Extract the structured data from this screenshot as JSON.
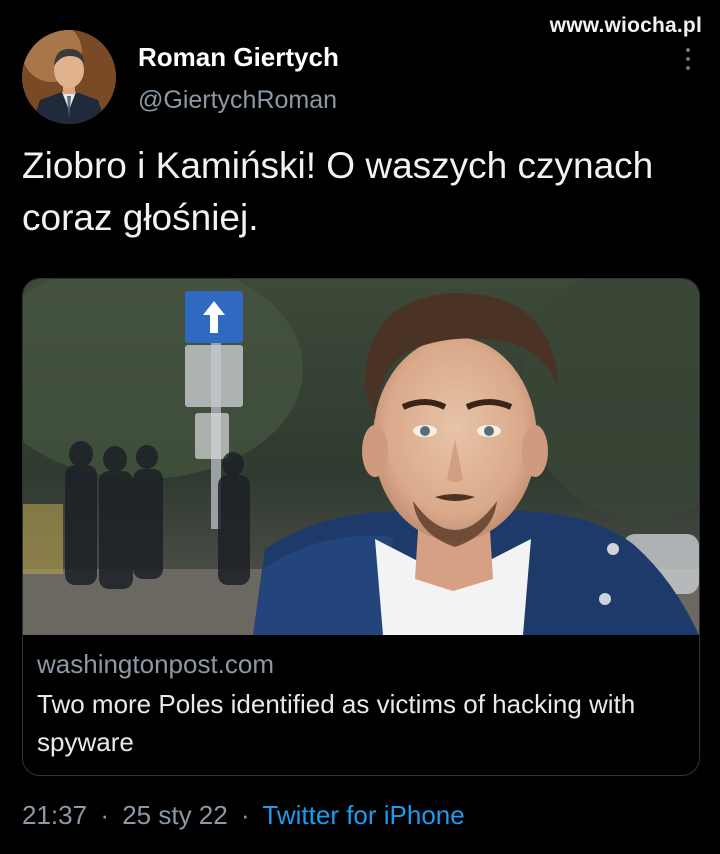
{
  "watermark": "www.wiocha.pl",
  "author": {
    "name": "Roman Giertych",
    "handle": "@GiertychRoman"
  },
  "tweet": {
    "text": "Ziobro i Kamiński! O waszych czynach coraz głośniej."
  },
  "link_card": {
    "domain": "washingtonpost.com",
    "title": "Two more Poles identified as victims of hacking with spyware"
  },
  "footer": {
    "time": "21:37",
    "separator": "·",
    "date": "25 sty 22",
    "source": "Twitter for iPhone"
  },
  "icons": {
    "more": "more-vertical-icon"
  },
  "colors": {
    "background": "#000000",
    "link": "#1d9bf0",
    "secondary_text": "#8b98a5",
    "card_border": "#2f3336"
  }
}
